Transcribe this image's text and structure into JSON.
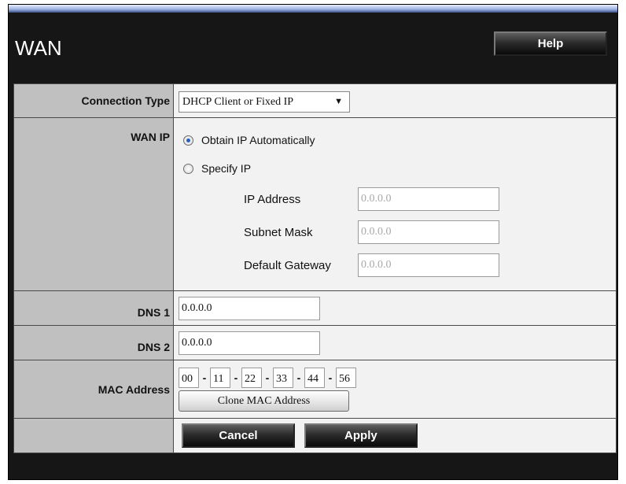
{
  "page": {
    "title": "WAN",
    "help_label": "Help"
  },
  "connection_type": {
    "label": "Connection Type",
    "selected": "DHCP Client or Fixed IP"
  },
  "wan_ip": {
    "label": "WAN IP",
    "obtain_label": "Obtain IP Automatically",
    "specify_label": "Specify IP",
    "selected": "obtain",
    "ip_address": {
      "label": "IP Address",
      "value": "0.0.0.0"
    },
    "subnet_mask": {
      "label": "Subnet Mask",
      "value": "0.0.0.0"
    },
    "default_gateway": {
      "label": "Default Gateway",
      "value": "0.0.0.0"
    }
  },
  "dns1": {
    "label": "DNS 1",
    "value": "0.0.0.0"
  },
  "dns2": {
    "label": "DNS 2",
    "value": "0.0.0.0"
  },
  "mac": {
    "label": "MAC Address",
    "parts": [
      "00",
      "11",
      "22",
      "33",
      "44",
      "56"
    ],
    "separator": "-",
    "clone_label": "Clone MAC Address"
  },
  "actions": {
    "cancel_label": "Cancel",
    "apply_label": "Apply"
  }
}
